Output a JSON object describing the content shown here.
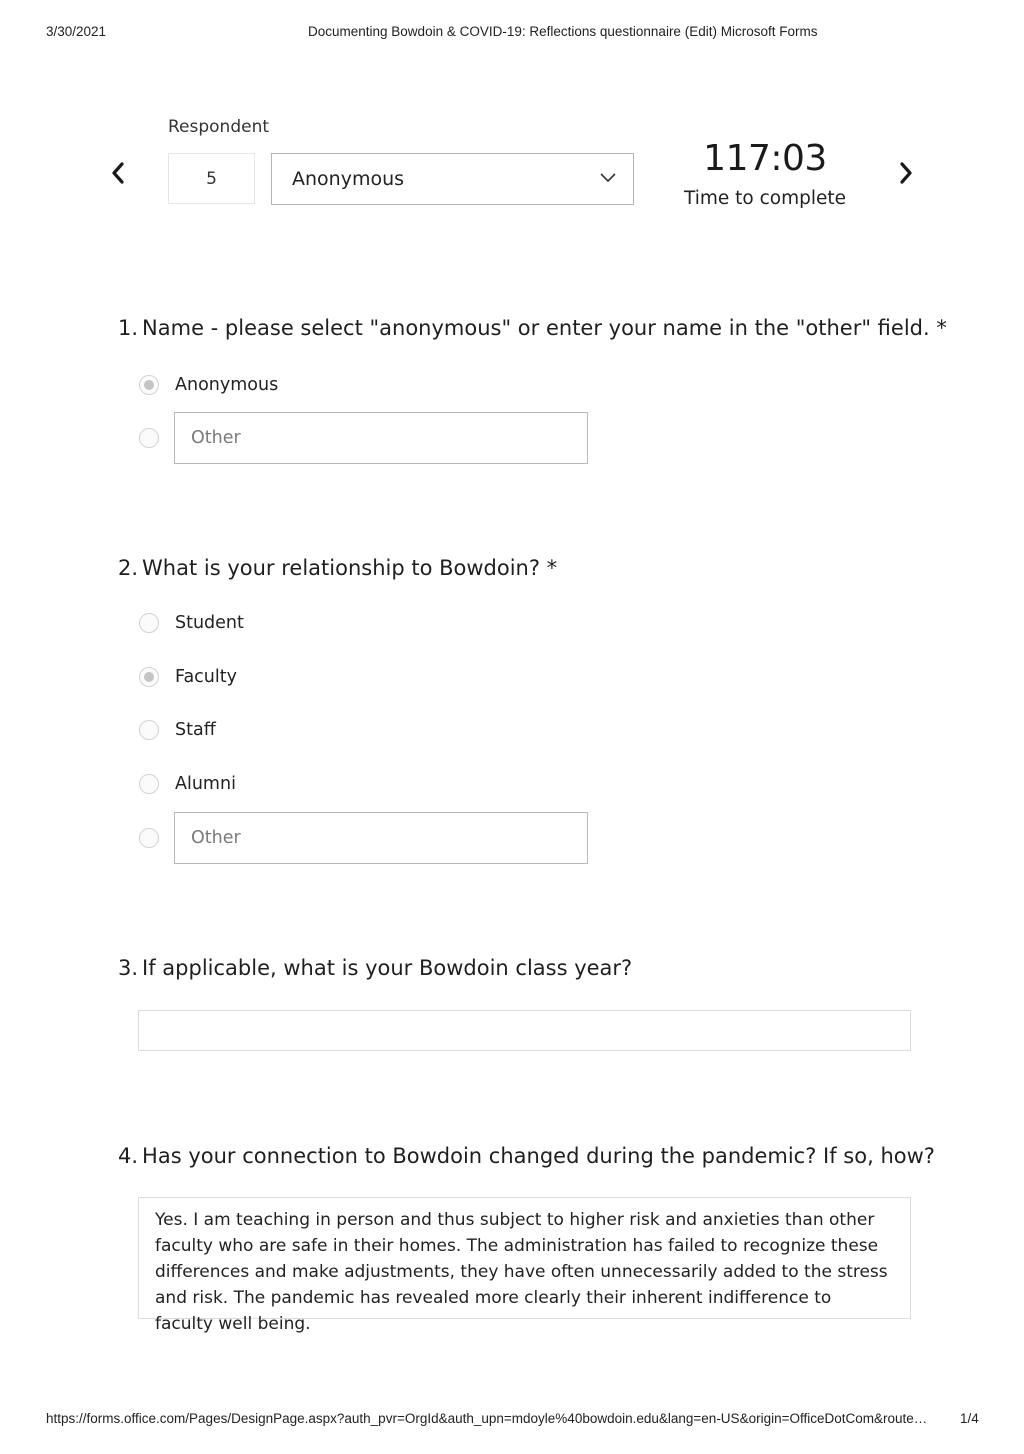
{
  "print_header": {
    "date": "3/30/2021",
    "title": "Documenting Bowdoin & COVID-19: Reflections questionnaire (Edit) Microsoft Forms"
  },
  "print_footer": {
    "url": "https://forms.office.com/Pages/DesignPage.aspx?auth_pvr=OrgId&auth_upn=mdoyle%40bowdoin.edu&lang=en-US&origin=OfficeDotCom&route…",
    "page": "1/4"
  },
  "respondent": {
    "label": "Respondent",
    "number": "5",
    "selected_name": "Anonymous",
    "prev_icon": "chevron-left-icon",
    "next_icon": "chevron-right-icon",
    "dropdown_icon": "chevron-down-icon",
    "time_value": "117:03",
    "time_label": "Time to complete"
  },
  "questions": [
    {
      "number": "1.",
      "title": "Name - please select \"anonymous\" or enter your name in the \"other\" field. *",
      "type": "choice",
      "options": [
        {
          "label": "Anonymous",
          "selected": true
        }
      ],
      "other_placeholder": "Other",
      "other_selected": false
    },
    {
      "number": "2.",
      "title": "What is your relationship to Bowdoin? *",
      "type": "choice",
      "options": [
        {
          "label": "Student",
          "selected": false
        },
        {
          "label": "Faculty",
          "selected": true
        },
        {
          "label": "Staff",
          "selected": false
        },
        {
          "label": "Alumni",
          "selected": false
        }
      ],
      "other_placeholder": "Other",
      "other_selected": false
    },
    {
      "number": "3.",
      "title": "If applicable, what is your Bowdoin class year?",
      "type": "text",
      "answer": ""
    },
    {
      "number": "4.",
      "title": "Has your connection to Bowdoin changed during the pandemic? If so, how?",
      "type": "text",
      "answer": "Yes. I am teaching in person and thus subject to higher risk and anxieties than other faculty who are safe in their homes. The administration has failed to recognize these differences and make adjustments, they have often unnecessarily added to the stress and risk. The pandemic has revealed more clearly their inherent indifference to faculty well being."
    }
  ]
}
